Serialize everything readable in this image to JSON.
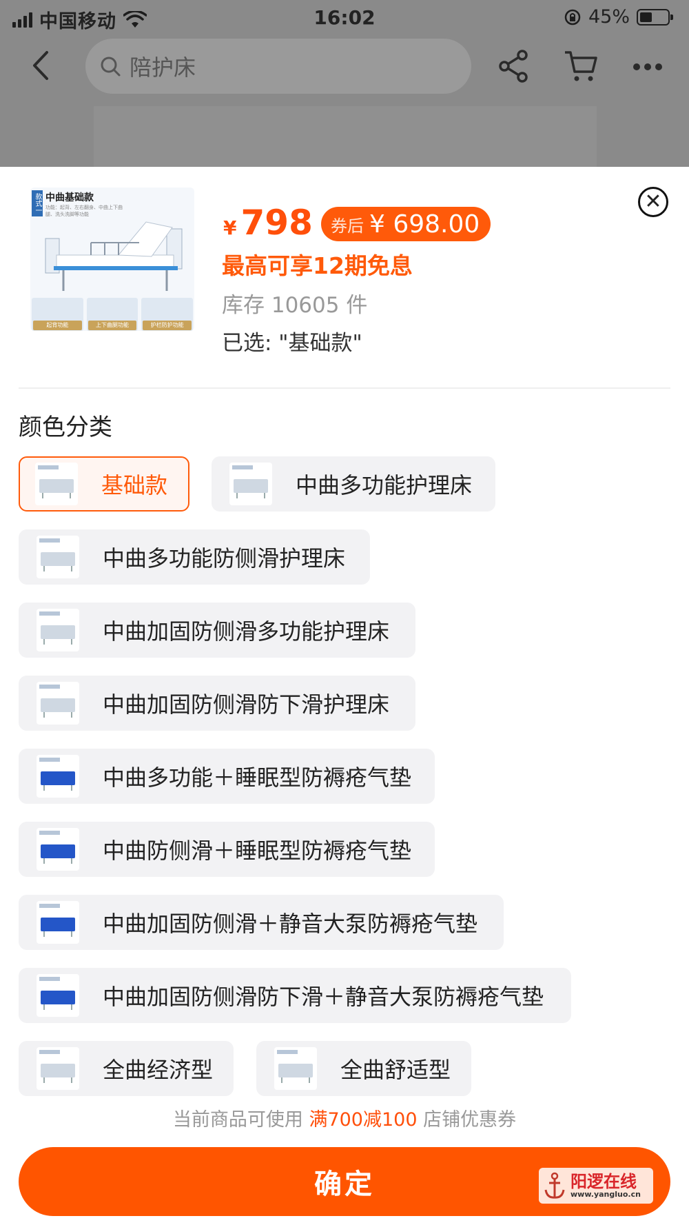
{
  "status_bar": {
    "carrier": "中国移动",
    "time": "16:02",
    "battery": "45%"
  },
  "nav": {
    "search_placeholder": "陪护床"
  },
  "product": {
    "thumb_badge": "款式一",
    "thumb_title": "中曲基础款",
    "thumb_subtitle": "功能：起背、左右翻身、中曲上下曲腿、洗头洗脚等功能",
    "thumb_features": [
      "起背功能",
      "上下曲腿功能",
      "护栏防护功能"
    ],
    "price_currency": "¥",
    "price": "798",
    "coupon_label": "券后",
    "coupon_price": "¥ 698.00",
    "installment": "最高可享12期免息",
    "stock": "库存 10605 件",
    "selected": "已选: \"基础款\""
  },
  "section_title": "颜色分类",
  "options": [
    {
      "label": "基础款",
      "selected": true,
      "blue": false
    },
    {
      "label": "中曲多功能护理床",
      "selected": false,
      "blue": false
    },
    {
      "label": "中曲多功能防侧滑护理床",
      "selected": false,
      "blue": false
    },
    {
      "label": "中曲加固防侧滑多功能护理床",
      "selected": false,
      "blue": false
    },
    {
      "label": "中曲加固防侧滑防下滑护理床",
      "selected": false,
      "blue": false
    },
    {
      "label": "中曲多功能＋睡眠型防褥疮气垫",
      "selected": false,
      "blue": true
    },
    {
      "label": "中曲防侧滑＋睡眠型防褥疮气垫",
      "selected": false,
      "blue": true
    },
    {
      "label": "中曲加固防侧滑＋静音大泵防褥疮气垫",
      "selected": false,
      "blue": true
    },
    {
      "label": "中曲加固防侧滑防下滑＋静音大泵防褥疮气垫",
      "selected": false,
      "blue": true
    },
    {
      "label": "全曲经济型",
      "selected": false,
      "blue": false
    },
    {
      "label": "全曲舒适型",
      "selected": false,
      "blue": false
    }
  ],
  "promo": {
    "prefix": "当前商品可使用 ",
    "highlight": "满700减100",
    "suffix": " 店铺优惠券"
  },
  "confirm_label": "确定",
  "watermark": {
    "title": "阳逻在线",
    "url": "www.yangluo.cn"
  },
  "colors": {
    "accent": "#ff5500",
    "price": "#ff4f0a"
  }
}
